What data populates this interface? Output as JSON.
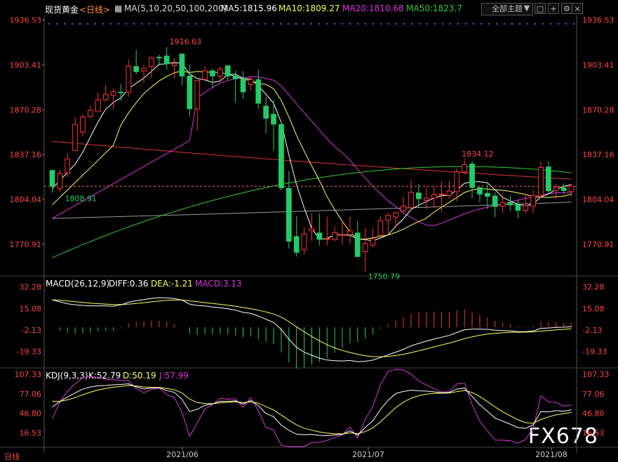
{
  "header": {
    "title": "现货黄金",
    "period": "<日线>",
    "ma_label": "MA(5,10,20,50,100,200)",
    "ma5": "MA5:1815.96",
    "ma10": "MA10:1809.27",
    "ma20": "MA20:1810.68",
    "ma50": "MA50:1823.7",
    "theme_button": "全部主题",
    "icon_button": "▼"
  },
  "colors": {
    "up": "#ff3232",
    "down": "#22cc66",
    "ma5": "#ffffff",
    "ma10": "#ffff55",
    "ma20": "#dd33dd",
    "ma50": "#33cc33",
    "ma100": "#dd3333",
    "ma200": "#999999",
    "axis_text": "#ff4444"
  },
  "main": {
    "yticks": [
      "1936.53",
      "1903.41",
      "1870.28",
      "1837.16",
      "1804.04",
      "1770.91"
    ],
    "annotations": {
      "high": "1916.63",
      "low": "1750.79",
      "start": "1808.91",
      "local_high": "1834.12"
    }
  },
  "macd": {
    "label": "MACD(26,12,9)",
    "diff": "DIFF:0.36",
    "dea": "DEA:-1.21",
    "macd": "MACD:3.13",
    "yticks": [
      "32.28",
      "15.08",
      "-2.13",
      "-19.33"
    ]
  },
  "kdj": {
    "label": "KDJ(9,3,3)",
    "k": "K:52.79",
    "d": "D:50.19",
    "j": "J:57.99",
    "yticks": [
      "107.33",
      "77.06",
      "46.80",
      "16.53"
    ]
  },
  "xaxis": {
    "period_label": "日线",
    "labels": [
      "2021/06",
      "2021/07",
      "2021/08"
    ]
  },
  "watermark": "FX678",
  "chart_data": {
    "type": "candlestick",
    "instrument": "现货黄金",
    "period": "日线",
    "ylim": [
      1748,
      1940
    ],
    "x_labels": [
      "2021/06",
      "2021/07",
      "2021/08"
    ],
    "candles": [
      {
        "o": 1825.5,
        "h": 1826,
        "l": 1808.9,
        "c": 1813.8
      },
      {
        "o": 1812,
        "h": 1826,
        "l": 1809.7,
        "c": 1823
      },
      {
        "o": 1823.5,
        "h": 1838,
        "l": 1820.6,
        "c": 1834
      },
      {
        "o": 1840.2,
        "h": 1864.7,
        "l": 1840.2,
        "c": 1859.4
      },
      {
        "o": 1853.8,
        "h": 1867.1,
        "l": 1850.8,
        "c": 1865
      },
      {
        "o": 1865.5,
        "h": 1873.6,
        "l": 1864.2,
        "c": 1869.9
      },
      {
        "o": 1868.9,
        "h": 1883,
        "l": 1868.9,
        "c": 1877.7
      },
      {
        "o": 1877.8,
        "h": 1888.9,
        "l": 1876.6,
        "c": 1881.8
      },
      {
        "o": 1881,
        "h": 1885.8,
        "l": 1870.6,
        "c": 1883.5
      },
      {
        "o": 1883.3,
        "h": 1889.1,
        "l": 1876.8,
        "c": 1883.2
      },
      {
        "o": 1883.3,
        "h": 1907.5,
        "l": 1880,
        "c": 1902.6
      },
      {
        "o": 1902.3,
        "h": 1914.6,
        "l": 1896.6,
        "c": 1898.5
      },
      {
        "o": 1898.9,
        "h": 1903.4,
        "l": 1890,
        "c": 1900.7
      },
      {
        "o": 1902.3,
        "h": 1909.7,
        "l": 1894,
        "c": 1908.8
      },
      {
        "o": 1909.1,
        "h": 1911.1,
        "l": 1902.7,
        "c": 1909
      },
      {
        "o": 1910,
        "h": 1916.6,
        "l": 1900,
        "c": 1904.3
      },
      {
        "o": 1903,
        "h": 1908.3,
        "l": 1893.4,
        "c": 1904.4
      },
      {
        "o": 1911.5,
        "h": 1911.5,
        "l": 1888.5,
        "c": 1895.2
      },
      {
        "o": 1895.2,
        "h": 1903.4,
        "l": 1865,
        "c": 1871
      },
      {
        "o": 1871,
        "h": 1892.1,
        "l": 1855,
        "c": 1892
      },
      {
        "o": 1892.7,
        "h": 1902.6,
        "l": 1892.3,
        "c": 1899
      },
      {
        "o": 1899.1,
        "h": 1900.5,
        "l": 1886.3,
        "c": 1895.3
      },
      {
        "o": 1895.2,
        "h": 1902.1,
        "l": 1891.3,
        "c": 1900.3
      },
      {
        "o": 1902.8,
        "h": 1902.8,
        "l": 1892.2,
        "c": 1895.2
      },
      {
        "o": 1895.2,
        "h": 1899.3,
        "l": 1875.6,
        "c": 1893.2
      },
      {
        "o": 1893.2,
        "h": 1898.9,
        "l": 1878.3,
        "c": 1883.5
      },
      {
        "o": 1889,
        "h": 1894.5,
        "l": 1884.3,
        "c": 1892.7
      },
      {
        "o": 1892.5,
        "h": 1899.8,
        "l": 1871,
        "c": 1875.1
      },
      {
        "o": 1873,
        "h": 1880,
        "l": 1853,
        "c": 1864
      },
      {
        "o": 1867,
        "h": 1877.5,
        "l": 1840,
        "c": 1859.7
      },
      {
        "o": 1859.4,
        "h": 1861.4,
        "l": 1810.8,
        "c": 1812.6
      },
      {
        "o": 1812.2,
        "h": 1825,
        "l": 1767.8,
        "c": 1773.2
      },
      {
        "o": 1776.6,
        "h": 1791.8,
        "l": 1761.9,
        "c": 1765
      },
      {
        "o": 1767,
        "h": 1783,
        "l": 1763.5,
        "c": 1778.5
      },
      {
        "o": 1781.1,
        "h": 1793.8,
        "l": 1773.4,
        "c": 1782.6
      },
      {
        "o": 1779.2,
        "h": 1793.5,
        "l": 1770,
        "c": 1774.5
      },
      {
        "o": 1774.4,
        "h": 1791.4,
        "l": 1770,
        "c": 1775
      },
      {
        "o": 1774.2,
        "h": 1784.3,
        "l": 1773.4,
        "c": 1779.5
      },
      {
        "o": 1777.5,
        "h": 1788.5,
        "l": 1770.5,
        "c": 1778
      },
      {
        "o": 1778,
        "h": 1791.5,
        "l": 1771,
        "c": 1780.7
      },
      {
        "o": 1779.2,
        "h": 1788,
        "l": 1765.8,
        "c": 1761.8
      },
      {
        "o": 1765.4,
        "h": 1783,
        "l": 1750.8,
        "c": 1771.5
      },
      {
        "o": 1770.4,
        "h": 1783,
        "l": 1768.7,
        "c": 1775
      },
      {
        "o": 1777.3,
        "h": 1791.5,
        "l": 1776.4,
        "c": 1788.4
      },
      {
        "o": 1788.5,
        "h": 1794.3,
        "l": 1777.9,
        "c": 1792.2
      },
      {
        "o": 1791,
        "h": 1795,
        "l": 1783.5,
        "c": 1794.2
      },
      {
        "o": 1795.4,
        "h": 1806,
        "l": 1794.6,
        "c": 1799
      },
      {
        "o": 1798,
        "h": 1818.3,
        "l": 1796.4,
        "c": 1809.2
      },
      {
        "o": 1808.8,
        "h": 1815.4,
        "l": 1797.4,
        "c": 1804.5
      },
      {
        "o": 1803.4,
        "h": 1813.5,
        "l": 1797,
        "c": 1805
      },
      {
        "o": 1805,
        "h": 1813.5,
        "l": 1798,
        "c": 1807.4
      },
      {
        "o": 1807.4,
        "h": 1817.6,
        "l": 1794.4,
        "c": 1808
      },
      {
        "o": 1807,
        "h": 1818,
        "l": 1804.5,
        "c": 1810.2
      },
      {
        "o": 1809.8,
        "h": 1826.8,
        "l": 1802.5,
        "c": 1824.6
      },
      {
        "o": 1824.3,
        "h": 1834.1,
        "l": 1822.5,
        "c": 1829.7
      },
      {
        "o": 1830.2,
        "h": 1832.4,
        "l": 1804.9,
        "c": 1812.9
      },
      {
        "o": 1812.8,
        "h": 1813,
        "l": 1802,
        "c": 1808
      },
      {
        "o": 1808.5,
        "h": 1815,
        "l": 1797,
        "c": 1806.3
      },
      {
        "o": 1806.5,
        "h": 1809.3,
        "l": 1791,
        "c": 1798.8
      },
      {
        "o": 1799,
        "h": 1807.4,
        "l": 1794,
        "c": 1801.5
      },
      {
        "o": 1801.6,
        "h": 1807,
        "l": 1795.7,
        "c": 1800
      },
      {
        "o": 1800,
        "h": 1803.6,
        "l": 1790,
        "c": 1796
      },
      {
        "o": 1796,
        "h": 1808,
        "l": 1793.8,
        "c": 1799.4
      },
      {
        "o": 1799,
        "h": 1810.8,
        "l": 1794,
        "c": 1806.8
      },
      {
        "o": 1807.1,
        "h": 1831.7,
        "l": 1805.4,
        "c": 1827.7
      },
      {
        "o": 1828,
        "h": 1832.4,
        "l": 1808.3,
        "c": 1810.4
      },
      {
        "o": 1810.6,
        "h": 1815.5,
        "l": 1804.4,
        "c": 1813
      },
      {
        "o": 1812.6,
        "h": 1816,
        "l": 1808,
        "c": 1810.6
      },
      {
        "o": 1809.8,
        "h": 1815.2,
        "l": 1806,
        "c": 1813.8
      }
    ],
    "ma5_last": 1815.96,
    "ma10_last": 1809.27,
    "ma20_last": 1810.68,
    "ma50_last": 1823.7,
    "macd_params": "26,12,9",
    "macd_diff_last": 0.36,
    "macd_dea_last": -1.21,
    "macd_hist_last": 3.13,
    "macd_ylim": [
      -32,
      40
    ],
    "kdj_params": "9,3,3",
    "kdj_k_last": 52.79,
    "kdj_d_last": 50.19,
    "kdj_j_last": 57.99,
    "kdj_ylim": [
      -5,
      115
    ]
  }
}
